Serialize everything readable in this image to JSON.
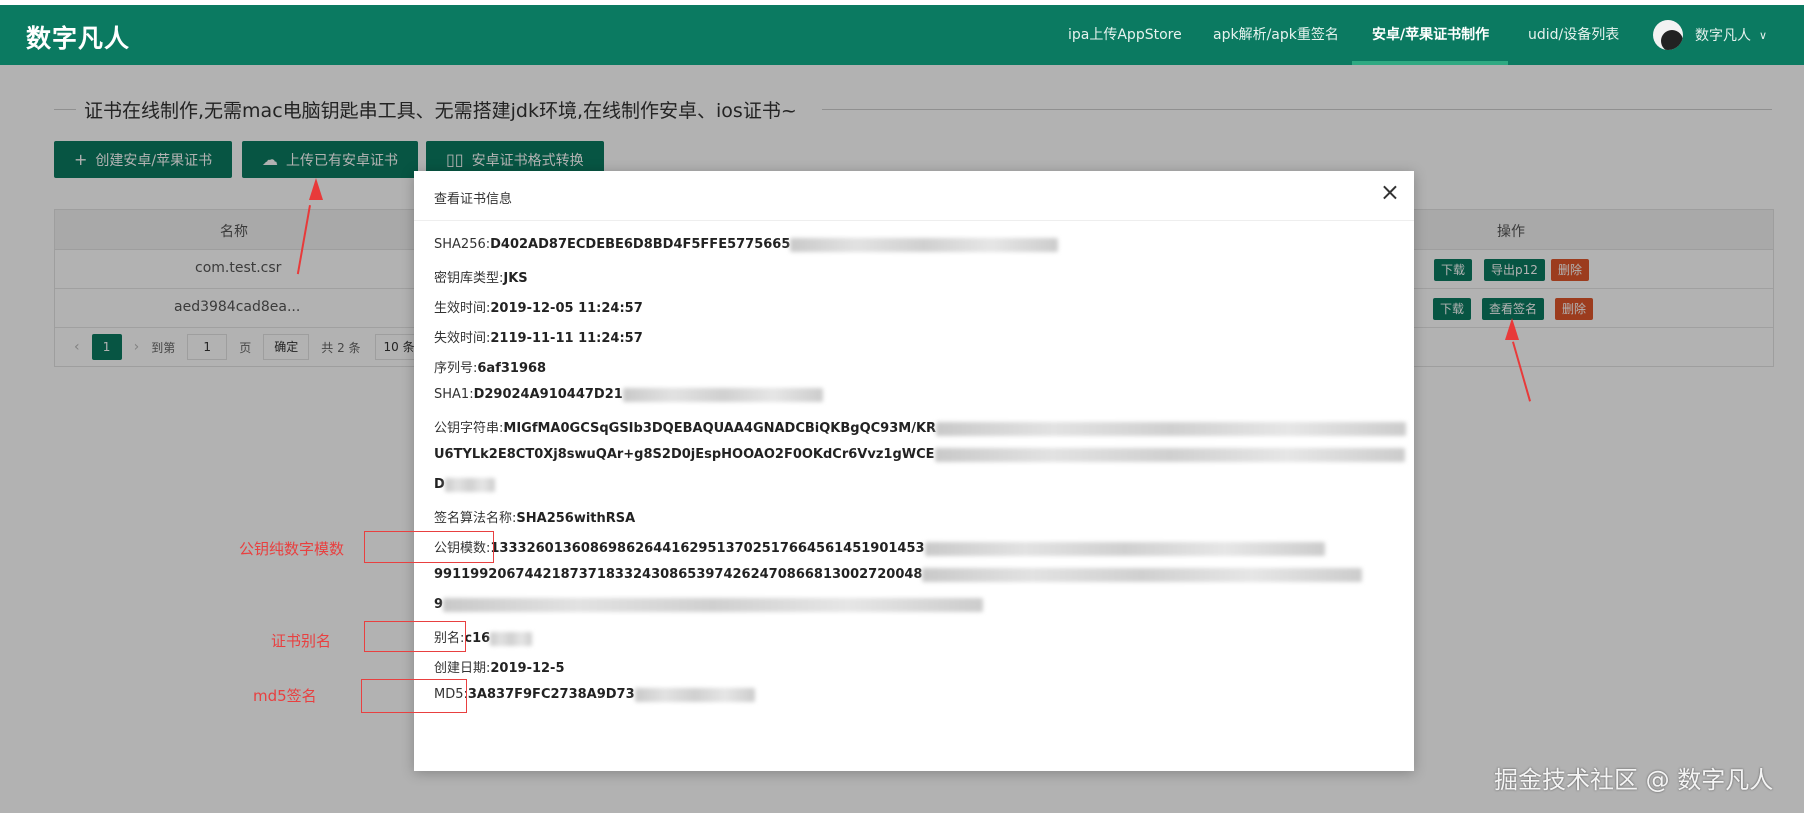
{
  "header": {
    "logo": "数字凡人",
    "nav": [
      {
        "label": "ipa上传AppStore"
      },
      {
        "label": "apk解析/apk重签名"
      },
      {
        "label": "安卓/苹果证书制作"
      },
      {
        "label": "udid/设备列表"
      }
    ],
    "user_name": "数字凡人",
    "user_chevron": "∨"
  },
  "page": {
    "intro": "证书在线制作,无需mac电脑钥匙串工具、无需搭建jdk环境,在线制作安卓、ios证书~",
    "buttons": {
      "create": "创建安卓/苹果证书",
      "upload": "上传已有安卓证书",
      "convert": "安卓证书格式转换"
    },
    "table": {
      "col_name": "名称",
      "col_ops": "操作",
      "rows": [
        {
          "name": "com.test.csr",
          "btn1": "下载",
          "btn2": "导出p12",
          "btn3": "删除"
        },
        {
          "name": "aed3984cad8ea...",
          "btn1": "下载",
          "btn2": "查看签名",
          "btn3": "删除"
        }
      ]
    },
    "pager": {
      "current": "1",
      "goto_prefix": "到第",
      "goto_value": "1",
      "goto_suffix": "页",
      "confirm": "确定",
      "total": "共 2 条",
      "page_size": "10 条/"
    }
  },
  "modal": {
    "title": "查看证书信息",
    "close": "×",
    "fields": {
      "sha256_label": "SHA256:",
      "sha256_value": "D402AD87ECDEBE6D8BD4F5FFE5775665",
      "store_type_label": "密钥库类型:",
      "store_type_value": "JKS",
      "valid_from_label": "生效时间:",
      "valid_from_value": "2019-12-05 11:24:57",
      "valid_to_label": "失效时间:",
      "valid_to_value": "2119-11-11 11:24:57",
      "serial_label": "序列号:",
      "serial_value": "6af31968",
      "sha1_label": "SHA1:",
      "sha1_value": "D29024A910447D21",
      "pubkey_label": "公钥字符串:",
      "pubkey_value_line1": "MIGfMA0GCSqGSIb3DQEBAQUAA4GNADCBiQKBgQC93M/KR",
      "pubkey_value_line2": "U6TYLk2E8CT0Xj8swuQAr+g8S2D0jEspHOOAO2F0OKdCr6Vvz1gWCE",
      "pubkey_value_line3": "D",
      "sig_alg_label": "签名算法名称:",
      "sig_alg_value": "SHA256withRSA",
      "modulus_label": "公钥模数:",
      "modulus_value_line1": "133326013608698626441629513702517664561451901453",
      "modulus_value_line2": "991199206744218737183324308653974262470866813002720048",
      "modulus_value_line3": "9",
      "alias_label": "别名:",
      "alias_value": "c16",
      "created_label": "创建日期:",
      "created_value": "2019-12-5",
      "md5_label": "MD5:",
      "md5_value": "3A837F9FC2738A9D73"
    }
  },
  "annotations": {
    "modulus_note": "公钥纯数字模数",
    "alias_note": "证书别名",
    "md5_note": "md5签名"
  },
  "watermark": "掘金技术社区 @ 数字凡人",
  "colors": {
    "brand_green": "#0b7a61",
    "danger_red": "#e0572b",
    "annotation_red": "#e84040"
  }
}
